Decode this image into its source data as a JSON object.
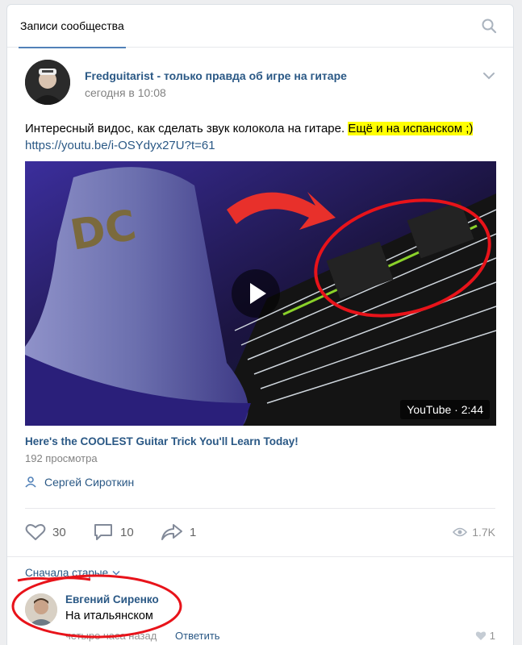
{
  "header": {
    "tab_label": "Записи сообщества"
  },
  "post": {
    "author": "Fredguitarist - только правда об игре на гитаре",
    "time": "сегодня в 10:08",
    "text_main": "Интересный видос, как сделать звук колокола на гитаре. ",
    "text_highlight": "Ещё и на испанском ;)",
    "link": "https://youtu.be/i-OSYdyx27U?t=61",
    "video": {
      "title": "Here's the COOLEST Guitar Trick You'll Learn Today!",
      "views": "192 просмотра",
      "badge": "YouTube · 2:44",
      "author": "Сергей Сироткин"
    },
    "stats": {
      "likes": "30",
      "comments": "10",
      "shares": "1",
      "views": "1.7K"
    }
  },
  "comments": {
    "sort_label": "Сначала старые",
    "items": [
      {
        "author": "Евгений Сиренко",
        "text": "На итальянском",
        "time": "четыре часа назад",
        "reply_label": "Ответить",
        "likes": "1"
      }
    ]
  },
  "colors": {
    "link": "#2a5885",
    "highlight": "#ffff00",
    "annotation": "#e8131a"
  }
}
